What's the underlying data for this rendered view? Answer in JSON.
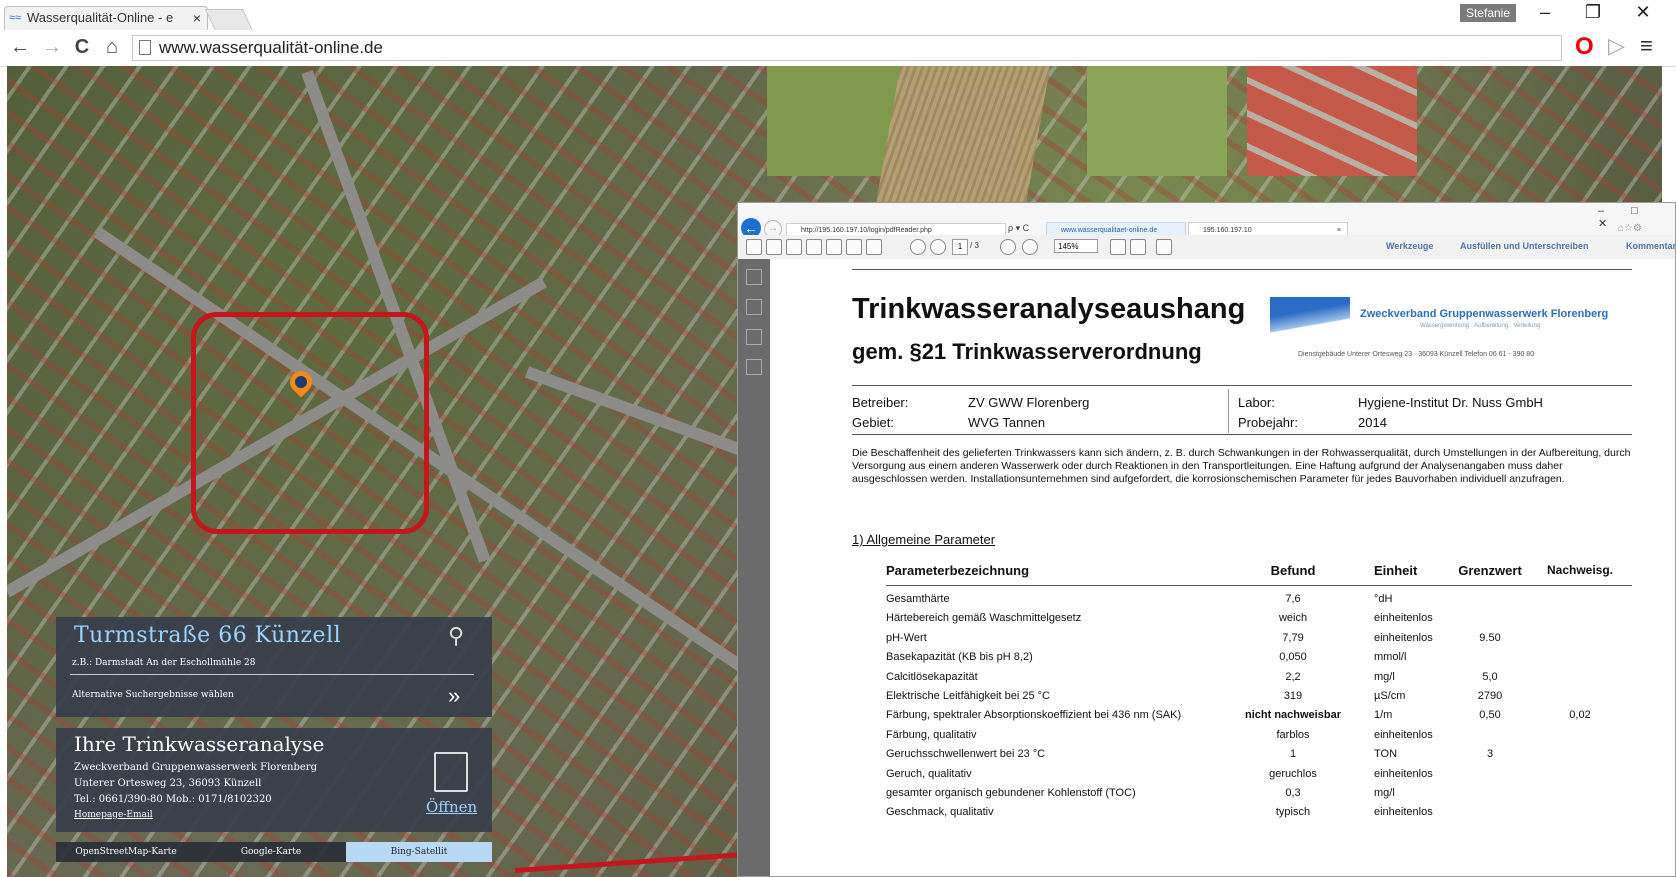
{
  "browser": {
    "tab_title": "Wasserqualität-Online - e",
    "tab_close": "×",
    "user": "Stefanie",
    "minimize": "–",
    "restore": "❐",
    "close": "✕",
    "back": "←",
    "forward": "→",
    "reload": "C",
    "home": "⌂",
    "url": "www.wasserqualität-online.de"
  },
  "map": {
    "search": {
      "query": "Turmstraße 66 Künzell",
      "hint": "z.B.: Darmstadt An der Escholl­mühle 28",
      "alternatives": "Alternative Suchergebnisse wählen",
      "chevron": "»"
    },
    "analysis": {
      "title": "Ihre Trinkwasseranalyse",
      "org": "Zweckverband Gruppenwasserwerk Florenberg",
      "street": "Unterer Ortesweg 23, 36093 Künzell",
      "phone": "Tel.: 0661/390-80 Mob.: 0171/8102320",
      "homepage": "Homepage",
      "sep": "-",
      "email": "Email",
      "open": "Öffnen"
    },
    "map_types": [
      "OpenStreetMap-Karte",
      "Google-Karte",
      "Bing-Satellit"
    ]
  },
  "pdf_viewer": {
    "address": "http://195.160.197.10/login/pdfReader.php",
    "search_glyph": "ρ ▾ C",
    "tab1": "www.wasserqualitaet-online.de",
    "tab2": "195.160.197.10",
    "tab_close": "×",
    "win_controls": "– □ ✕",
    "favs": "⌂☆⚙",
    "page_current": "1",
    "page_total": "/ 3",
    "zoom": "145%",
    "tools": [
      "Werkzeuge",
      "Ausfüllen und Unterschreiben",
      "Kommentar"
    ]
  },
  "document": {
    "title": "Trinkwasseranalyseaushang",
    "subtitle": "gem. §21 Trinkwasserverordnung",
    "logo_name": "Zweckverband Gruppenwasserwerk Florenberg",
    "logo_tagline": "Wassergewinnung · Aufbereitung · Verteilung",
    "logo_address": "Dienstgebäude Unterer Ortesweg 23 · 36093 Künzell Telefon 06 61 - 390 80",
    "operator_label": "Betreiber:",
    "operator": "ZV GWW Florenberg",
    "area_label": "Gebiet:",
    "area": "WVG Tannen",
    "lab_label": "Labor:",
    "lab": "Hygiene-Institut Dr. Nuss GmbH",
    "year_label": "Probejahr:",
    "year": "2014",
    "disclaimer": "Die Beschaffenheit des gelieferten Trinkwassers kann sich ändern, z. B. durch Schwankungen in der Rohwasserqualität, durch Umstellungen in der Aufbereitung, durch Versorgung aus einem anderen Wasserwerk oder durch Reaktionen in den Transportleitungen. Eine Haftung aufgrund der Analysenangaben muss daher ausgeschlossen werden. Installationsunternehmen sind aufgefordert, die korrosionschemischen Parameter für jedes Bauvorhaben individuell anzufragen.",
    "section": "1) Allgemeine Parameter",
    "columns": [
      "Parameterbezeichnung",
      "Befund",
      "Einheit",
      "Grenzwert",
      "Nachweisg."
    ],
    "rows": [
      [
        "Gesamthärte",
        "7,6",
        "°dH",
        "",
        ""
      ],
      [
        "Härtebereich gemäß Waschmittelgesetz",
        "weich",
        "einheitenlos",
        "",
        ""
      ],
      [
        "pH-Wert",
        "7,79",
        "einheitenlos",
        "9.50",
        ""
      ],
      [
        "Basekapazität (KB bis pH 8,2)",
        "0,050",
        "mmol/l",
        "",
        ""
      ],
      [
        "Calcitlösekapazität",
        "2,2",
        "mg/l",
        "5,0",
        ""
      ],
      [
        "Elektrische Leitfähigkeit bei 25 °C",
        "319",
        "µS/cm",
        "2790",
        ""
      ],
      [
        "Färbung, spektraler Absorptionskoeffizient bei 436 nm (SAK)",
        "nicht nachweisbar",
        "1/m",
        "0,50",
        "0,02"
      ],
      [
        "Färbung, qualitativ",
        "farblos",
        "einheitenlos",
        "",
        ""
      ],
      [
        "Geruchsschwellenwert bei 23 °C",
        "1",
        "TON",
        "3",
        ""
      ],
      [
        "Geruch, qualitativ",
        "geruchlos",
        "einheitenlos",
        "",
        ""
      ],
      [
        "gesamter organisch gebundener Kohlenstoff (TOC)",
        "0,3",
        "mg/l",
        "",
        ""
      ],
      [
        "Geschmack, qualitativ",
        "typisch",
        "einheitenlos",
        "",
        ""
      ]
    ]
  }
}
